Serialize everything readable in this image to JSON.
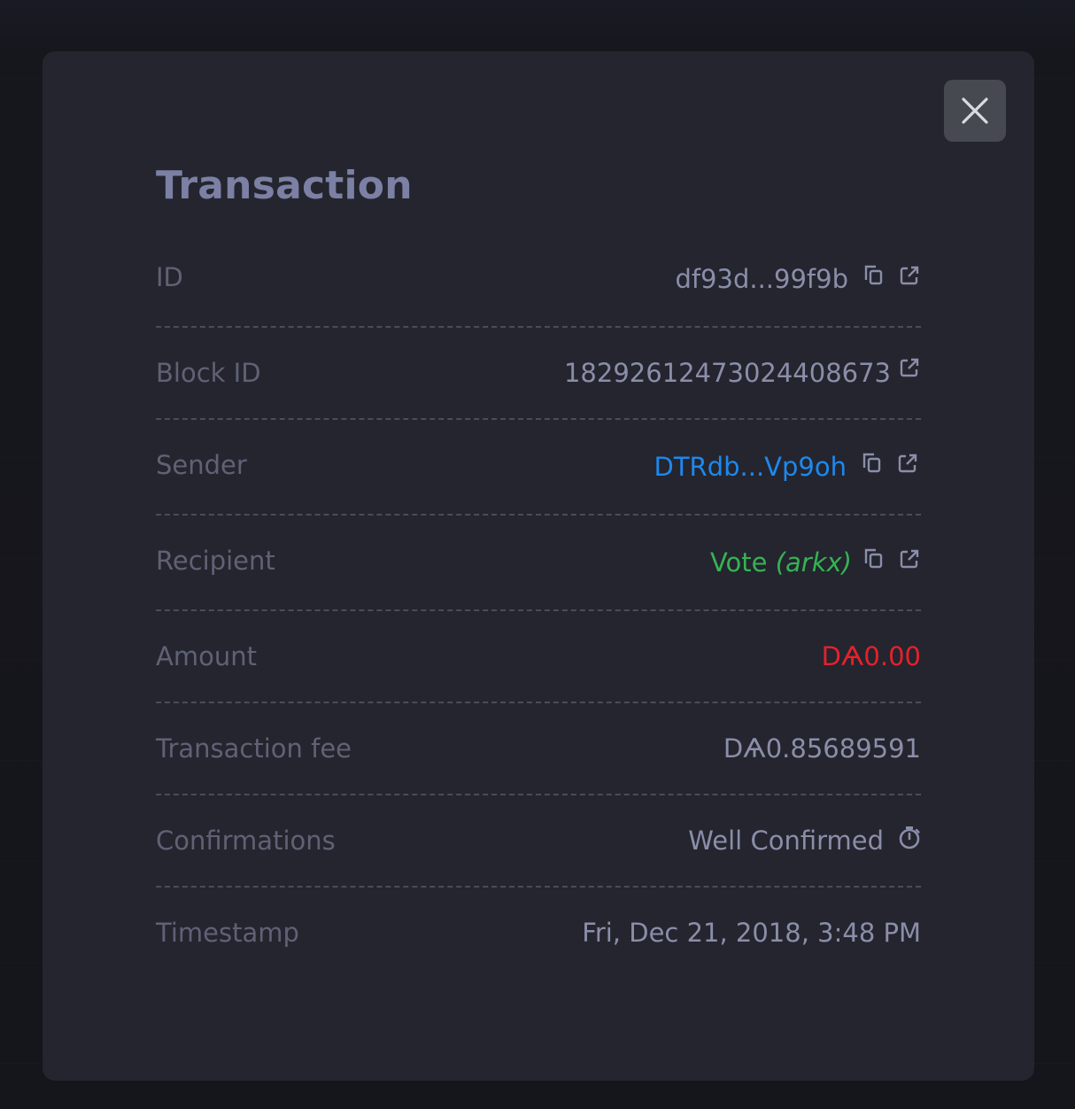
{
  "modal": {
    "title": "Transaction",
    "close_icon": "close-icon"
  },
  "rows": {
    "id": {
      "label": "ID",
      "value": "df93d...99f9b"
    },
    "block_id": {
      "label": "Block ID",
      "value": "1829261247302440867­3"
    },
    "sender": {
      "label": "Sender",
      "value": "DTRdb...Vp9oh",
      "color": "#1d88ee"
    },
    "recipient": {
      "label": "Recipient",
      "value": "Vote",
      "sub": "(arkx)",
      "color": "#36b255"
    },
    "amount": {
      "label": "Amount",
      "value": "DѦ0.00",
      "color": "#e5212c"
    },
    "fee": {
      "label": "Transaction fee",
      "value": "DѦ0.85689591"
    },
    "confirmations": {
      "label": "Confirmations",
      "value": "Well Confirmed",
      "icon": "stopwatch-icon"
    },
    "timestamp": {
      "label": "Timestamp",
      "value": "Fri, Dec 21, 2018, 3:48 PM"
    }
  },
  "icons": {
    "copy": "copy-icon",
    "external": "external-link-icon"
  }
}
